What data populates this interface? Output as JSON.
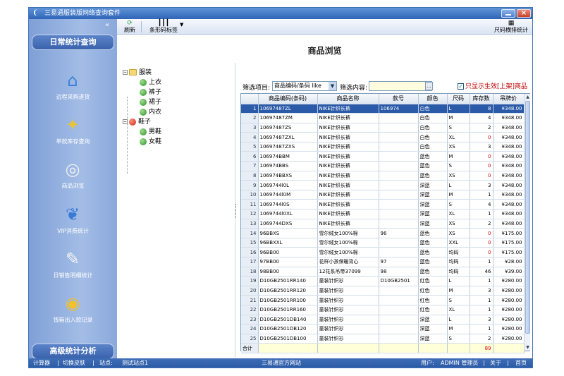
{
  "window": {
    "title": "三易通服装版网络查询套件"
  },
  "toolbar": {
    "refresh": "刷新",
    "barcode_tag": "条形码标签",
    "size_stats": "尺码横排统计"
  },
  "sidebar": {
    "header_top": "日常统计查询",
    "header_bottom": "高级统计分析",
    "items": [
      {
        "label": "远程采购进货",
        "icon": "house-truck-icon"
      },
      {
        "label": "单款库存查询",
        "icon": "stock-query-icon"
      },
      {
        "label": "商品浏览",
        "icon": "browse-icon"
      },
      {
        "label": "VIP消费统计",
        "icon": "vip-icon"
      },
      {
        "label": "日销售明细统计",
        "icon": "sales-chart-icon"
      },
      {
        "label": "钱箱出入款记录",
        "icon": "cashbox-icon"
      }
    ]
  },
  "page_title": "商品浏览",
  "tree": {
    "root1": "服装",
    "root1_children": [
      "上衣",
      "裤子",
      "裙子",
      "内衣"
    ],
    "root2": "鞋子",
    "root2_children": [
      "男鞋",
      "女鞋"
    ]
  },
  "filter": {
    "label": "筛选项目:",
    "selected": "商品编码/条码 like",
    "search_label": "筛选内容:",
    "search_value": "",
    "show_active_label": "只显示生效[上架]商品",
    "show_active_checked": true
  },
  "grid": {
    "columns": [
      "商品编码(条码)",
      "商品名称",
      "款号",
      "颜色",
      "尺码",
      "库存数",
      "吊牌价"
    ],
    "rows": [
      [
        "1",
        "10697487ZL",
        "NIKE针织长裤",
        "106974",
        "白色",
        "L",
        "8",
        "¥348.00"
      ],
      [
        "2",
        "10697487ZM",
        "NIKE针织长裤",
        "",
        "白色",
        "M",
        "4",
        "¥348.00"
      ],
      [
        "3",
        "10697487ZS",
        "NIKE针织长裤",
        "",
        "白色",
        "S",
        "2",
        "¥348.00"
      ],
      [
        "4",
        "10697487ZXL",
        "NIKE针织长裤",
        "",
        "白色",
        "XL",
        "0",
        "¥348.00"
      ],
      [
        "5",
        "10697487ZXS",
        "NIKE针织长裤",
        "",
        "白色",
        "XS",
        "3",
        "¥348.00"
      ],
      [
        "6",
        "106974BBM",
        "NIKE针织长裤",
        "",
        "蓝色",
        "M",
        "0",
        "¥348.00"
      ],
      [
        "7",
        "106974BBS",
        "NIKE针织长裤",
        "",
        "蓝色",
        "S",
        "0",
        "¥348.00"
      ],
      [
        "8",
        "106974BBXS",
        "NIKE针织长裤",
        "",
        "蓝色",
        "XS",
        "0",
        "¥348.00"
      ],
      [
        "9",
        "1069744l0L",
        "NIKE针织长裤",
        "",
        "深蓝",
        "L",
        "3",
        "¥348.00"
      ],
      [
        "10",
        "1069744l0M",
        "NIKE针织长裤",
        "",
        "深蓝",
        "M",
        "1",
        "¥348.00"
      ],
      [
        "11",
        "1069744l0S",
        "NIKE针织长裤",
        "",
        "深蓝",
        "S",
        "4",
        "¥348.00"
      ],
      [
        "12",
        "1069744l0XL",
        "NIKE针织长裤",
        "",
        "深蓝",
        "XL",
        "1",
        "¥348.00"
      ],
      [
        "13",
        "1069744DXS",
        "NIKE针织长裤",
        "",
        "深蓝",
        "XS",
        "2",
        "¥348.00"
      ],
      [
        "14",
        "96BBXS",
        "雪尔绒女100%棉",
        "96",
        "蓝色",
        "XS",
        "0",
        "¥175.00"
      ],
      [
        "15",
        "96BBXXL",
        "雪尔绒女100%棉",
        "",
        "蓝色",
        "XXL",
        "0",
        "¥175.00"
      ],
      [
        "16",
        "96BB00",
        "雪尔绒女100%棉",
        "",
        "蓝色",
        "均码",
        "0",
        "¥175.00"
      ],
      [
        "17",
        "97BB00",
        "花样小孩保暖背心",
        "97",
        "蓝色",
        "均码",
        "1",
        "¥28.00"
      ],
      [
        "18",
        "98BB00",
        "12花系吊带37099",
        "98",
        "蓝色",
        "均码",
        "46",
        "¥39.00"
      ],
      [
        "19",
        "D10GB2501RR140",
        "童装针织衫",
        "D10GB2501",
        "红色",
        "L",
        "1",
        "¥280.00"
      ],
      [
        "20",
        "D10GB2501RR120",
        "童装针织衫",
        "",
        "红色",
        "M",
        "3",
        "¥280.00"
      ],
      [
        "21",
        "D10GB2501RR100",
        "童装针织衫",
        "",
        "红色",
        "S",
        "1",
        "¥280.00"
      ],
      [
        "22",
        "D10GB2501RR160",
        "童装针织衫",
        "",
        "红色",
        "XL",
        "1",
        "¥280.00"
      ],
      [
        "23",
        "D10GB2501DB140",
        "童装针织衫",
        "",
        "深蓝",
        "L",
        "3",
        "¥280.00"
      ],
      [
        "24",
        "D10GB2501DB120",
        "童装针织衫",
        "",
        "深蓝",
        "M",
        "1",
        "¥280.00"
      ],
      [
        "25",
        "D10GB2501DB100",
        "童装针织衫",
        "",
        "深蓝",
        "S",
        "2",
        "¥280.00"
      ]
    ],
    "total_label": "合计",
    "total_stock": "89"
  },
  "statusbar": {
    "calculator": "计算器",
    "skin": "切换皮肤",
    "site_label": "站点:",
    "site_value": "测试站点1",
    "website": "三易通官方网站",
    "user_label": "用户:",
    "user_value": "ADMIN 管理员",
    "about": "关于",
    "home": "首页",
    "sep": "|"
  },
  "colors": {
    "accent": "#2a5aa8",
    "sidebar": "#8aa8db",
    "zero_stock": "#e00000"
  }
}
